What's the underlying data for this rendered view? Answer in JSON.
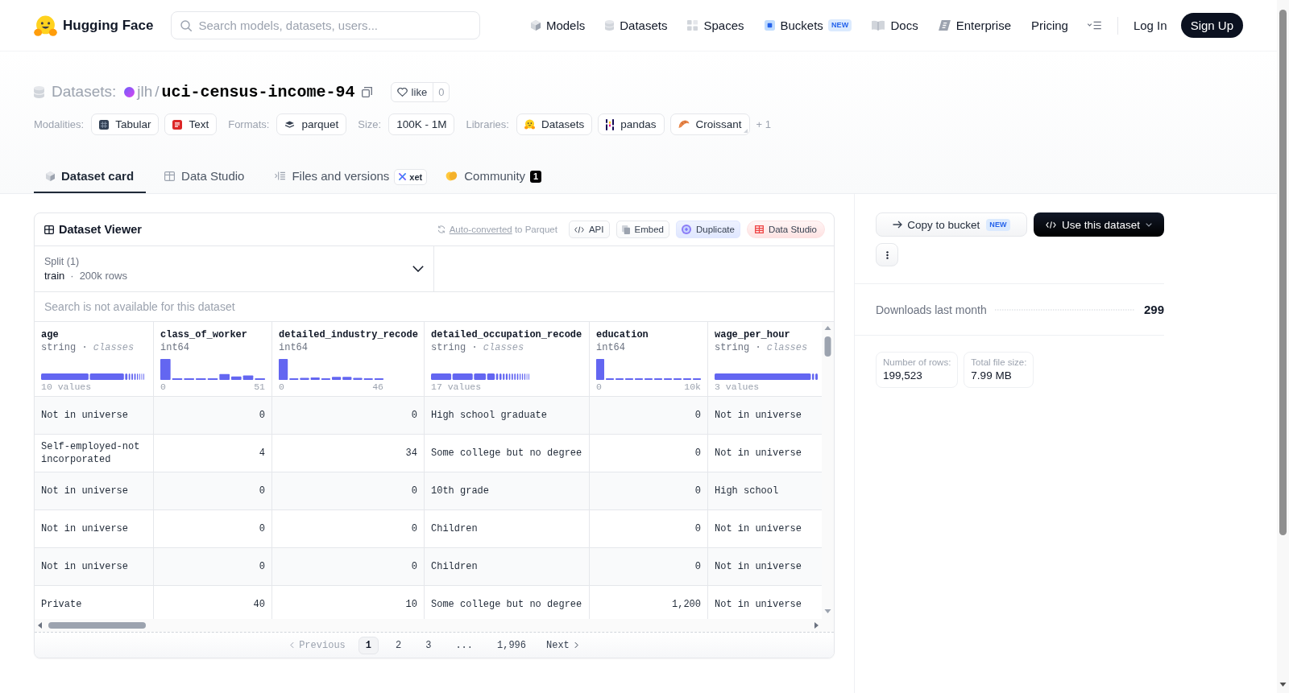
{
  "header": {
    "logo": "Hugging Face",
    "search": {
      "placeholder": "Search models, datasets, users..."
    },
    "nav": [
      {
        "label": "Models",
        "kind": "models"
      },
      {
        "label": "Datasets",
        "kind": "datasets"
      },
      {
        "label": "Spaces",
        "kind": "spaces"
      },
      {
        "label": "Buckets",
        "kind": "buckets",
        "badge": "NEW"
      },
      {
        "label": "Docs",
        "kind": "docs"
      },
      {
        "label": "Enterprise",
        "kind": "enterprise"
      },
      {
        "label": "Pricing",
        "kind": "pricing"
      }
    ],
    "login": "Log In",
    "signup": "Sign Up"
  },
  "repo": {
    "type": "Datasets:",
    "owner": "jlh",
    "separator": "/",
    "name": "uci-census-income-94",
    "like": {
      "label": "like",
      "count": "0"
    }
  },
  "tag_groups": [
    {
      "label": "Modalities:",
      "tags": [
        {
          "text": "Tabular",
          "kind": "tabular"
        },
        {
          "text": "Text",
          "kind": "text"
        }
      ]
    },
    {
      "label": "Formats:",
      "tags": [
        {
          "text": "parquet",
          "kind": "parquet"
        }
      ]
    },
    {
      "label": "Size:",
      "tags": [
        {
          "text": "100K - 1M",
          "kind": "size"
        }
      ]
    },
    {
      "label": "Libraries:",
      "tags": [
        {
          "text": "Datasets",
          "kind": "datasets"
        },
        {
          "text": "pandas",
          "kind": "pandas"
        },
        {
          "text": "Croissant",
          "kind": "croissant"
        }
      ],
      "more": "+ 1"
    }
  ],
  "tabs": [
    {
      "label": "Dataset card",
      "kind": "card",
      "selected": true
    },
    {
      "label": "Data Studio",
      "kind": "studio",
      "selected": false
    },
    {
      "label": "Files and versions",
      "kind": "files",
      "selected": false,
      "badge": "xet"
    },
    {
      "label": "Community",
      "kind": "community",
      "selected": false,
      "count": "1"
    }
  ],
  "viewer": {
    "title": "Dataset Viewer",
    "conversion": {
      "link": "Auto-converted",
      "text": "to Parquet"
    },
    "actions": [
      {
        "label": "API",
        "kind": "api"
      },
      {
        "label": "Embed",
        "kind": "embed"
      },
      {
        "label": "Duplicate",
        "kind": "duplicate"
      },
      {
        "label": "Data Studio",
        "kind": "studio"
      }
    ],
    "split": {
      "label": "Split (1)",
      "value": "train",
      "separator": "·",
      "rows": "200k rows"
    },
    "search": {
      "placeholder": "Search is not available for this dataset"
    },
    "columns": [
      {
        "name": "age",
        "type": "string · *classes*",
        "kind": "classes",
        "summary": "10 values"
      },
      {
        "name": "class_of_worker",
        "type": "int64",
        "kind": "histogram",
        "min": "0",
        "max": "51"
      },
      {
        "name": "detailed_industry_recode",
        "type": "int64",
        "kind": "histogram",
        "min": "0",
        "max": "46"
      },
      {
        "name": "detailed_occupation_recode",
        "type": "string · *classes*",
        "kind": "classes",
        "summary": "17 values"
      },
      {
        "name": "education",
        "type": "int64",
        "kind": "histogram",
        "min": "0",
        "max": "10k"
      },
      {
        "name": "wage_per_hour",
        "type": "string · *classes*",
        "kind": "classes",
        "summary": "3 values"
      }
    ],
    "rows": [
      [
        "Not in universe",
        "0",
        "0",
        "High school graduate",
        "0",
        "Not in universe"
      ],
      [
        "Self-employed-not incorporated",
        "4",
        "34",
        "Some college but no degree",
        "0",
        "Not in universe"
      ],
      [
        "Not in universe",
        "0",
        "0",
        "10th grade",
        "0",
        "High school"
      ],
      [
        "Not in universe",
        "0",
        "0",
        "Children",
        "0",
        "Not in universe"
      ],
      [
        "Not in universe",
        "0",
        "0",
        "Children",
        "0",
        "Not in universe"
      ],
      [
        "Private",
        "40",
        "10",
        "Some college but no degree",
        "1,200",
        "Not in universe"
      ]
    ],
    "pagination": {
      "previous": {
        "label": "Previous",
        "disabled": true
      },
      "pages": [
        {
          "label": "1",
          "selected": true
        },
        {
          "label": "2",
          "selected": false
        },
        {
          "label": "3",
          "selected": false
        },
        {
          "label": "...",
          "selected": false
        },
        {
          "label": "1,996",
          "selected": false
        }
      ],
      "next": {
        "label": "Next",
        "disabled": false
      }
    }
  },
  "sidebar": {
    "copy_button": {
      "label": "Copy to bucket",
      "badge": "NEW"
    },
    "use_button": {
      "label": "Use this dataset"
    },
    "downloads": {
      "label": "Downloads last month",
      "value": "299"
    },
    "stats": [
      {
        "label": "Number of rows:",
        "value": "199,523"
      },
      {
        "label": "Total file size:",
        "value": "7.99 MB"
      }
    ]
  }
}
